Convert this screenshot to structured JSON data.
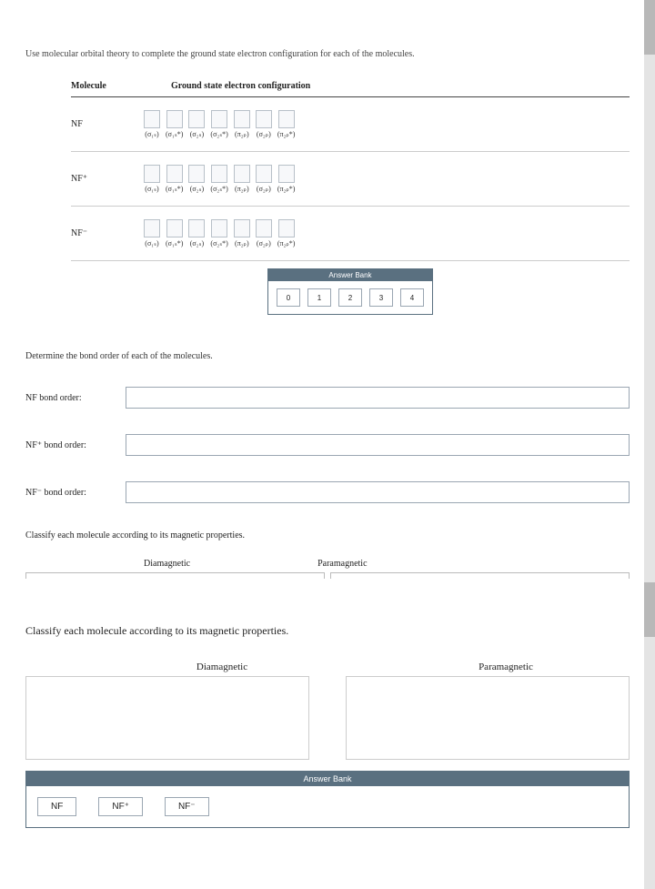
{
  "intro": "Use molecular orbital theory to complete the ground state electron configuration for each of the molecules.",
  "table": {
    "molecule_header": "Molecule",
    "config_header": "Ground state electron configuration",
    "rows": [
      {
        "label": "NF"
      },
      {
        "label": "NF⁺"
      },
      {
        "label": "NF⁻"
      }
    ],
    "orbital_labels": [
      "(σ₁ₛ)",
      "(σ₁ₛ*)",
      "(σ₂ₛ)",
      "(σ₂ₛ*)",
      "(π₂ₚ)",
      "(σ₂ₚ)",
      "(π₂ₚ*)"
    ]
  },
  "answer_bank": {
    "title": "Answer Bank",
    "tiles": [
      "0",
      "1",
      "2",
      "3",
      "4"
    ]
  },
  "bond_order": {
    "title": "Determine the bond order of each of the molecules.",
    "rows": [
      {
        "label": "NF bond order:"
      },
      {
        "label": "NF⁺ bond order:"
      },
      {
        "label": "NF⁻ bond order:"
      }
    ]
  },
  "mag_mini": {
    "title": "Classify each molecule according to its magnetic properties.",
    "zones": [
      "Diamagnetic",
      "Paramagnetic"
    ]
  },
  "mag_big": {
    "title": "Classify each molecule according to its magnetic properties.",
    "zones": [
      "Diamagnetic",
      "Paramagnetic"
    ],
    "bank_title": "Answer Bank",
    "chips": [
      "NF",
      "NF⁺",
      "NF⁻"
    ]
  }
}
